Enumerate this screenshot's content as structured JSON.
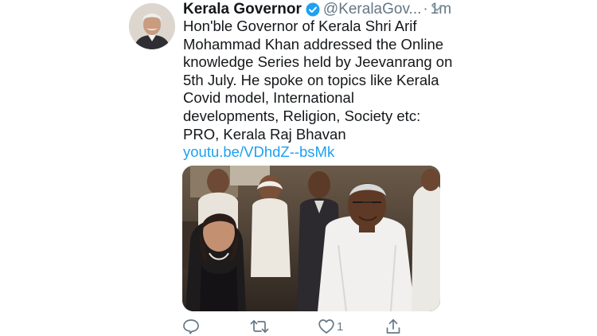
{
  "tweet": {
    "display_name": "Kerala Governor",
    "handle": "@KeralaGov...",
    "separator": "·",
    "time": "1m",
    "text_lines": [
      "Hon'ble Governor of Kerala Shri Arif",
      "Mohammad Khan addressed the  Online",
      "knowledge Series held by Jeevanrang on",
      "5th July. He spoke on topics like Kerala",
      "Covid model, International",
      "developments, Religion, Society etc:",
      "PRO, Kerala Raj Bhavan"
    ],
    "link": "youtu.be/VDhdZ--bsMk",
    "like_count": "1"
  },
  "colors": {
    "text": "#14171a",
    "secondary": "#657786",
    "link": "#1da1f2",
    "verified": "#1da1f2"
  },
  "icons": {
    "verified": "verified-badge-icon",
    "menu": "chevron-down-icon",
    "reply": "reply-icon",
    "retweet": "retweet-icon",
    "like": "heart-icon",
    "share": "share-icon"
  }
}
